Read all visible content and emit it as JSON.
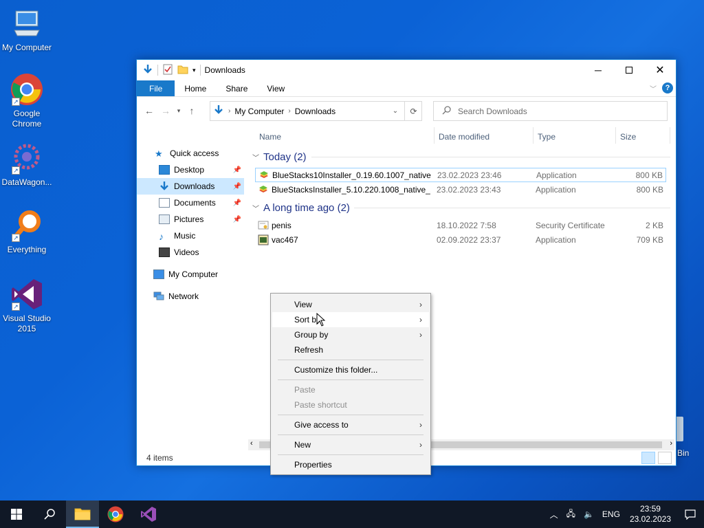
{
  "desktop": {
    "icons": [
      {
        "label": "My Computer"
      },
      {
        "label": "Google Chrome"
      },
      {
        "label": "DataWagon..."
      },
      {
        "label": "Everything"
      },
      {
        "label": "Visual Studio 2015"
      }
    ],
    "recycle_label": "Bin"
  },
  "window": {
    "title": "Downloads",
    "ribbon_tabs": [
      "File",
      "Home",
      "Share",
      "View"
    ],
    "address": {
      "crumbs": [
        "My Computer",
        "Downloads"
      ]
    },
    "search_placeholder": "Search Downloads",
    "nav_pane": {
      "quick_access": "Quick access",
      "items": [
        {
          "label": "Desktop",
          "pinned": true
        },
        {
          "label": "Downloads",
          "pinned": true
        },
        {
          "label": "Documents",
          "pinned": true
        },
        {
          "label": "Pictures",
          "pinned": true
        },
        {
          "label": "Music",
          "pinned": false
        },
        {
          "label": "Videos",
          "pinned": false
        }
      ],
      "this_pc": "My Computer",
      "network": "Network"
    },
    "columns": [
      "Name",
      "Date modified",
      "Type",
      "Size"
    ],
    "groups": [
      {
        "label": "Today (2)",
        "files": [
          {
            "name": "BlueStacks10Installer_0.19.60.1007_native...",
            "date": "23.02.2023 23:46",
            "type": "Application",
            "size": "800 KB"
          },
          {
            "name": "BlueStacksInstaller_5.10.220.1008_native_...",
            "date": "23.02.2023 23:43",
            "type": "Application",
            "size": "800 KB"
          }
        ]
      },
      {
        "label": "A long time ago (2)",
        "files": [
          {
            "name": "penis",
            "date": "18.10.2022 7:58",
            "type": "Security Certificate",
            "size": "2 KB"
          },
          {
            "name": "vac467",
            "date": "02.09.2022 23:37",
            "type": "Application",
            "size": "709 KB"
          }
        ]
      }
    ],
    "status": "4 items"
  },
  "context_menu": {
    "items": [
      {
        "label": "View",
        "submenu": true,
        "disabled": false
      },
      {
        "label": "Sort by",
        "submenu": true,
        "disabled": false
      },
      {
        "label": "Group by",
        "submenu": true,
        "disabled": false
      },
      {
        "label": "Refresh",
        "submenu": false,
        "disabled": false
      },
      {
        "label": "Customize this folder...",
        "submenu": false,
        "disabled": false
      },
      {
        "label": "Paste",
        "submenu": false,
        "disabled": true
      },
      {
        "label": "Paste shortcut",
        "submenu": false,
        "disabled": true
      },
      {
        "label": "Give access to",
        "submenu": true,
        "disabled": false
      },
      {
        "label": "New",
        "submenu": true,
        "disabled": false
      },
      {
        "label": "Properties",
        "submenu": false,
        "disabled": false
      }
    ]
  },
  "taskbar": {
    "language": "ENG",
    "time": "23:59",
    "date": "23.02.2023"
  },
  "colors": {
    "accent": "#1979ca",
    "selection": "#cce8ff",
    "group_header": "#1e3287"
  }
}
